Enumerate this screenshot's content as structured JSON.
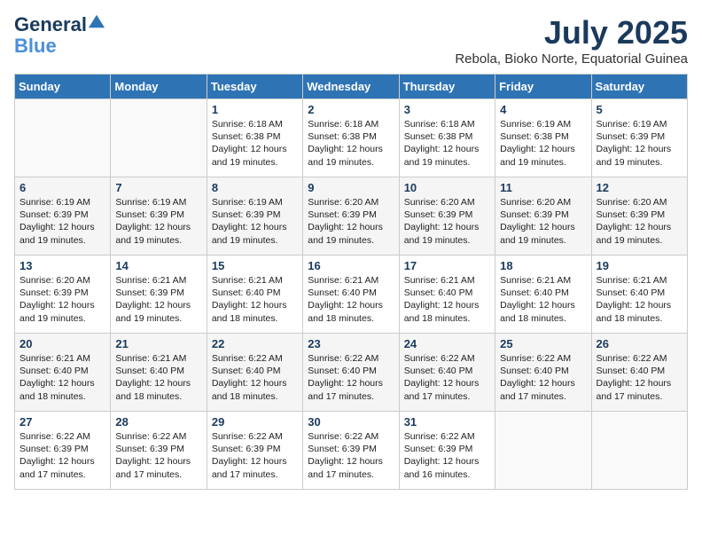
{
  "header": {
    "logo_line1": "General",
    "logo_line2": "Blue",
    "month_year": "July 2025",
    "location": "Rebola, Bioko Norte, Equatorial Guinea"
  },
  "days_of_week": [
    "Sunday",
    "Monday",
    "Tuesday",
    "Wednesday",
    "Thursday",
    "Friday",
    "Saturday"
  ],
  "weeks": [
    [
      {
        "day": "",
        "info": ""
      },
      {
        "day": "",
        "info": ""
      },
      {
        "day": "1",
        "info": "Sunrise: 6:18 AM\nSunset: 6:38 PM\nDaylight: 12 hours and 19 minutes."
      },
      {
        "day": "2",
        "info": "Sunrise: 6:18 AM\nSunset: 6:38 PM\nDaylight: 12 hours and 19 minutes."
      },
      {
        "day": "3",
        "info": "Sunrise: 6:18 AM\nSunset: 6:38 PM\nDaylight: 12 hours and 19 minutes."
      },
      {
        "day": "4",
        "info": "Sunrise: 6:19 AM\nSunset: 6:38 PM\nDaylight: 12 hours and 19 minutes."
      },
      {
        "day": "5",
        "info": "Sunrise: 6:19 AM\nSunset: 6:39 PM\nDaylight: 12 hours and 19 minutes."
      }
    ],
    [
      {
        "day": "6",
        "info": "Sunrise: 6:19 AM\nSunset: 6:39 PM\nDaylight: 12 hours and 19 minutes."
      },
      {
        "day": "7",
        "info": "Sunrise: 6:19 AM\nSunset: 6:39 PM\nDaylight: 12 hours and 19 minutes."
      },
      {
        "day": "8",
        "info": "Sunrise: 6:19 AM\nSunset: 6:39 PM\nDaylight: 12 hours and 19 minutes."
      },
      {
        "day": "9",
        "info": "Sunrise: 6:20 AM\nSunset: 6:39 PM\nDaylight: 12 hours and 19 minutes."
      },
      {
        "day": "10",
        "info": "Sunrise: 6:20 AM\nSunset: 6:39 PM\nDaylight: 12 hours and 19 minutes."
      },
      {
        "day": "11",
        "info": "Sunrise: 6:20 AM\nSunset: 6:39 PM\nDaylight: 12 hours and 19 minutes."
      },
      {
        "day": "12",
        "info": "Sunrise: 6:20 AM\nSunset: 6:39 PM\nDaylight: 12 hours and 19 minutes."
      }
    ],
    [
      {
        "day": "13",
        "info": "Sunrise: 6:20 AM\nSunset: 6:39 PM\nDaylight: 12 hours and 19 minutes."
      },
      {
        "day": "14",
        "info": "Sunrise: 6:21 AM\nSunset: 6:39 PM\nDaylight: 12 hours and 19 minutes."
      },
      {
        "day": "15",
        "info": "Sunrise: 6:21 AM\nSunset: 6:40 PM\nDaylight: 12 hours and 18 minutes."
      },
      {
        "day": "16",
        "info": "Sunrise: 6:21 AM\nSunset: 6:40 PM\nDaylight: 12 hours and 18 minutes."
      },
      {
        "day": "17",
        "info": "Sunrise: 6:21 AM\nSunset: 6:40 PM\nDaylight: 12 hours and 18 minutes."
      },
      {
        "day": "18",
        "info": "Sunrise: 6:21 AM\nSunset: 6:40 PM\nDaylight: 12 hours and 18 minutes."
      },
      {
        "day": "19",
        "info": "Sunrise: 6:21 AM\nSunset: 6:40 PM\nDaylight: 12 hours and 18 minutes."
      }
    ],
    [
      {
        "day": "20",
        "info": "Sunrise: 6:21 AM\nSunset: 6:40 PM\nDaylight: 12 hours and 18 minutes."
      },
      {
        "day": "21",
        "info": "Sunrise: 6:21 AM\nSunset: 6:40 PM\nDaylight: 12 hours and 18 minutes."
      },
      {
        "day": "22",
        "info": "Sunrise: 6:22 AM\nSunset: 6:40 PM\nDaylight: 12 hours and 18 minutes."
      },
      {
        "day": "23",
        "info": "Sunrise: 6:22 AM\nSunset: 6:40 PM\nDaylight: 12 hours and 17 minutes."
      },
      {
        "day": "24",
        "info": "Sunrise: 6:22 AM\nSunset: 6:40 PM\nDaylight: 12 hours and 17 minutes."
      },
      {
        "day": "25",
        "info": "Sunrise: 6:22 AM\nSunset: 6:40 PM\nDaylight: 12 hours and 17 minutes."
      },
      {
        "day": "26",
        "info": "Sunrise: 6:22 AM\nSunset: 6:40 PM\nDaylight: 12 hours and 17 minutes."
      }
    ],
    [
      {
        "day": "27",
        "info": "Sunrise: 6:22 AM\nSunset: 6:39 PM\nDaylight: 12 hours and 17 minutes."
      },
      {
        "day": "28",
        "info": "Sunrise: 6:22 AM\nSunset: 6:39 PM\nDaylight: 12 hours and 17 minutes."
      },
      {
        "day": "29",
        "info": "Sunrise: 6:22 AM\nSunset: 6:39 PM\nDaylight: 12 hours and 17 minutes."
      },
      {
        "day": "30",
        "info": "Sunrise: 6:22 AM\nSunset: 6:39 PM\nDaylight: 12 hours and 17 minutes."
      },
      {
        "day": "31",
        "info": "Sunrise: 6:22 AM\nSunset: 6:39 PM\nDaylight: 12 hours and 16 minutes."
      },
      {
        "day": "",
        "info": ""
      },
      {
        "day": "",
        "info": ""
      }
    ]
  ]
}
